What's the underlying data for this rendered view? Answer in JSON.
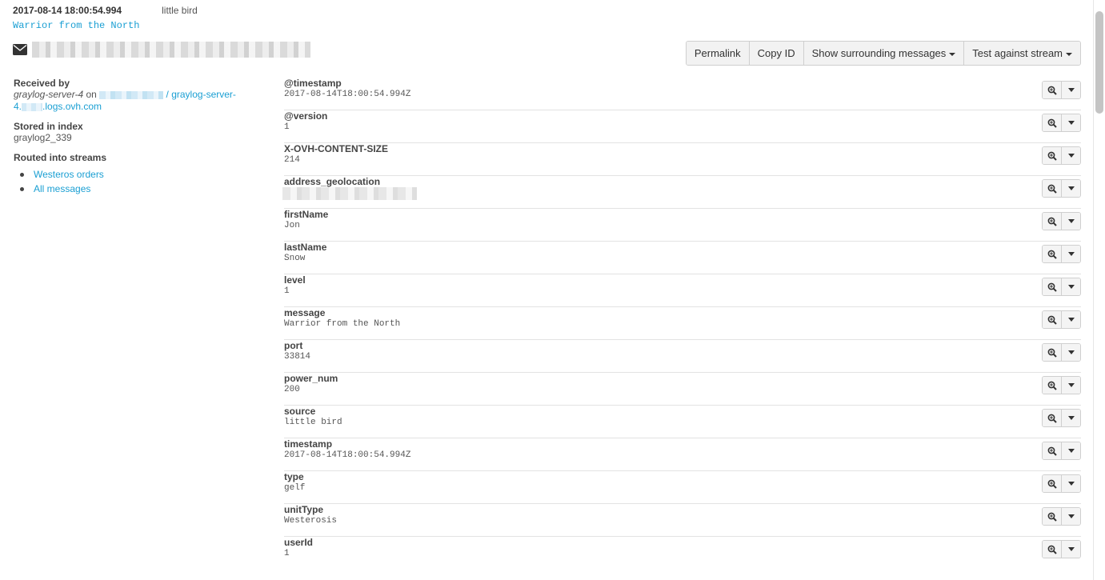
{
  "message": {
    "timestamp": "2017-08-14 18:00:54.994",
    "source": "little bird",
    "text": "Warrior from the North"
  },
  "toolbar": {
    "permalink": "Permalink",
    "copy_id": "Copy ID",
    "show_surrounding": "Show surrounding messages",
    "test_stream": "Test against stream"
  },
  "meta": {
    "received_by_label": "Received by",
    "node_name": "graylog-server-4",
    "on_word": "on",
    "node_link_suffix": "/ graylog-server-",
    "node_host_prefix": "4.",
    "node_host_suffix": ".logs.ovh.com",
    "stored_label": "Stored in index",
    "index_name": "graylog2_339",
    "routed_label": "Routed into streams",
    "streams": [
      "Westeros orders",
      "All messages"
    ]
  },
  "fields": [
    {
      "name": "@timestamp",
      "value": "2017-08-14T18:00:54.994Z"
    },
    {
      "name": "@version",
      "value": "1"
    },
    {
      "name": "X-OVH-CONTENT-SIZE",
      "value": "214"
    },
    {
      "name": "address_geolocation",
      "value": ""
    },
    {
      "name": "firstName",
      "value": "Jon"
    },
    {
      "name": "lastName",
      "value": "Snow"
    },
    {
      "name": "level",
      "value": "1"
    },
    {
      "name": "message",
      "value": "Warrior from the North"
    },
    {
      "name": "port",
      "value": "33814"
    },
    {
      "name": "power_num",
      "value": "200"
    },
    {
      "name": "source",
      "value": "little bird"
    },
    {
      "name": "timestamp",
      "value": "2017-08-14T18:00:54.994Z"
    },
    {
      "name": "type",
      "value": "gelf"
    },
    {
      "name": "unitType",
      "value": "Westerosis"
    },
    {
      "name": "userId",
      "value": "1"
    }
  ],
  "icons": {
    "envelope": "envelope-icon",
    "zoom": "zoom-in-icon",
    "caret": "caret-down-icon"
  },
  "colors": {
    "link": "#1a9fd3",
    "text": "#333333",
    "button_bg": "#f2f2f2"
  }
}
